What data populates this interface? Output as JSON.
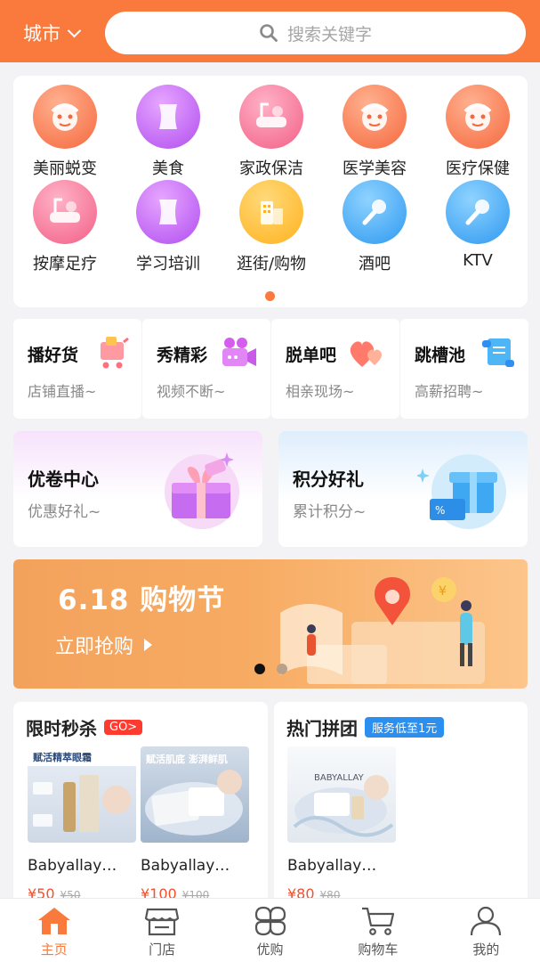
{
  "header": {
    "city_label": "城市",
    "search_placeholder": "搜索关键字"
  },
  "categories": [
    {
      "label": "美丽蜕变",
      "icon": "face-icon",
      "color": "orange"
    },
    {
      "label": "美食",
      "icon": "torso-icon",
      "color": "purple"
    },
    {
      "label": "家政保洁",
      "icon": "bathtub-icon",
      "color": "pink"
    },
    {
      "label": "医学美容",
      "icon": "face-icon",
      "color": "orange"
    },
    {
      "label": "医疗保健",
      "icon": "face-icon",
      "color": "orange"
    },
    {
      "label": "按摩足疗",
      "icon": "bathtub-icon",
      "color": "pink"
    },
    {
      "label": "学习培训",
      "icon": "torso-icon",
      "color": "purple"
    },
    {
      "label": "逛街/购物",
      "icon": "building-icon",
      "color": "yellow"
    },
    {
      "label": "酒吧",
      "icon": "microphone-icon",
      "color": "blue"
    },
    {
      "label": "KTV",
      "icon": "microphone-icon",
      "color": "blue"
    }
  ],
  "features": [
    {
      "title": "播好货",
      "subtitle": "店铺直播~",
      "icon": "shopping-cart-icon"
    },
    {
      "title": "秀精彩",
      "subtitle": "视频不断~",
      "icon": "video-camera-icon"
    },
    {
      "title": "脱单吧",
      "subtitle": "相亲现场~",
      "icon": "hearts-icon"
    },
    {
      "title": "跳槽池",
      "subtitle": "高薪招聘~",
      "icon": "scroll-icon"
    }
  ],
  "promos": [
    {
      "title": "优卷中心",
      "subtitle": "优惠好礼~",
      "icon": "gift-box-icon"
    },
    {
      "title": "积分好礼",
      "subtitle": "累计积分~",
      "icon": "gift-coupon-icon"
    }
  ],
  "banner": {
    "title": "6.18 购物节",
    "cta": "立即抢购"
  },
  "flash_sale": {
    "title": "限时秒杀",
    "badge": "GO>",
    "products": [
      {
        "name": "Babyallay…",
        "price": "¥50",
        "old_price": "¥50",
        "img_text": "赋活精萃眼霜"
      },
      {
        "name": "Babyallay…",
        "price": "¥100",
        "old_price": "¥100",
        "img_text": "赋活肌底 澎湃鲜肌"
      }
    ]
  },
  "group_buy": {
    "title": "热门拼团",
    "badge": "服务低至1元",
    "products": [
      {
        "name": "Babyallay…",
        "price": "¥80",
        "old_price": "¥80",
        "img_text": "BABYALLAY"
      }
    ]
  },
  "bottom_nav": [
    {
      "label": "主页",
      "icon": "home-icon",
      "active": true
    },
    {
      "label": "门店",
      "icon": "store-icon",
      "active": false
    },
    {
      "label": "优购",
      "icon": "grid-petals-icon",
      "active": false
    },
    {
      "label": "购物车",
      "icon": "cart-icon",
      "active": false
    },
    {
      "label": "我的",
      "icon": "user-icon",
      "active": false
    }
  ],
  "colors": {
    "brand": "#fa7a3d",
    "price": "#f25030",
    "badge_red": "#ff3b30",
    "badge_blue": "#2b8ff0"
  }
}
